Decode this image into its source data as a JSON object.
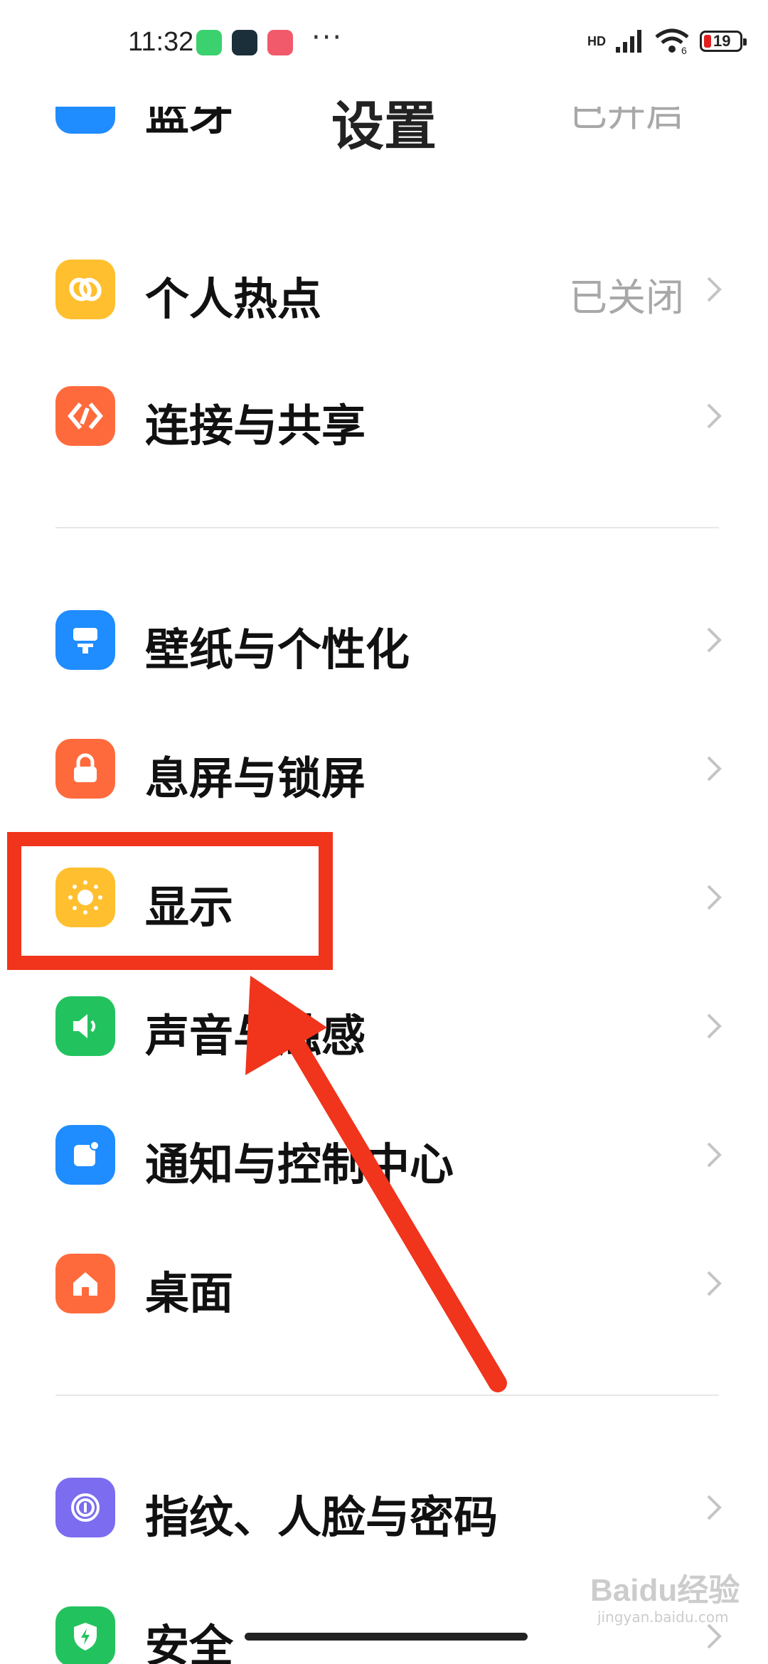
{
  "status_bar": {
    "time": "11:32",
    "network_label": "HD",
    "battery_level": "19",
    "overflow": "···"
  },
  "page": {
    "title": "设置"
  },
  "settings_items": [
    {
      "label": "蓝牙",
      "value": "已开启",
      "icon": "bluetooth-icon",
      "color": "#1f8cff"
    },
    {
      "label": "个人热点",
      "value": "已关闭",
      "icon": "hotspot-icon",
      "color": "#ffbf2e"
    },
    {
      "label": "连接与共享",
      "value": "",
      "icon": "connection-share-icon",
      "color": "#ff6a3d"
    },
    {
      "label": "壁纸与个性化",
      "value": "",
      "icon": "wallpaper-icon",
      "color": "#1f8cff"
    },
    {
      "label": "息屏与锁屏",
      "value": "",
      "icon": "lock-icon",
      "color": "#ff6a3d"
    },
    {
      "label": "显示",
      "value": "",
      "icon": "brightness-icon",
      "color": "#ffbf2e"
    },
    {
      "label": "声音与触感",
      "value": "",
      "icon": "speaker-icon",
      "color": "#22c35e"
    },
    {
      "label": "通知与控制中心",
      "value": "",
      "icon": "notification-icon",
      "color": "#1f8cff"
    },
    {
      "label": "桌面",
      "value": "",
      "icon": "home-icon",
      "color": "#ff6a3d"
    },
    {
      "label": "指纹、人脸与密码",
      "value": "",
      "icon": "fingerprint-icon",
      "color": "#7b6cf0"
    },
    {
      "label": "安全",
      "value": "",
      "icon": "shield-icon",
      "color": "#22c35e"
    }
  ],
  "watermark": {
    "brand": "Baidu经验",
    "url": "jingyan.baidu.com"
  },
  "colors": {
    "highlight": "#f1341c",
    "chevron": "#c4c4c4"
  }
}
